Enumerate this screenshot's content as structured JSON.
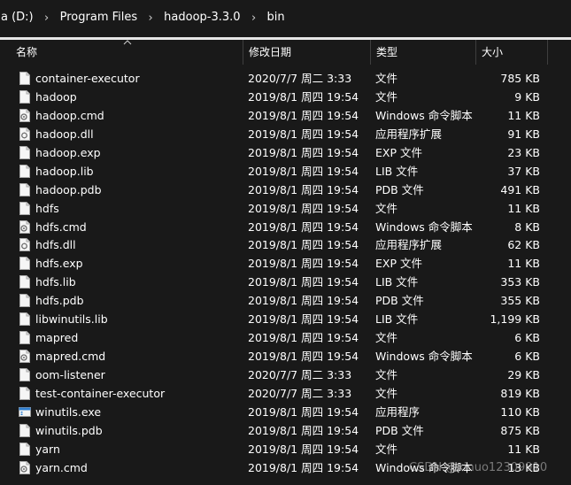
{
  "breadcrumb": [
    {
      "label": "a (D:)"
    },
    {
      "label": "Program Files"
    },
    {
      "label": "hadoop-3.3.0"
    },
    {
      "label": "bin"
    }
  ],
  "breadcrumb_separator": "›",
  "columns": {
    "name": "名称",
    "date": "修改日期",
    "type": "类型",
    "size": "大小"
  },
  "files": [
    {
      "name": "container-executor",
      "date": "2020/7/7 周二 3:33",
      "type": "文件",
      "size": "785 KB",
      "icon": "blank-file-icon"
    },
    {
      "name": "hadoop",
      "date": "2019/8/1 周四 19:54",
      "type": "文件",
      "size": "9 KB",
      "icon": "blank-file-icon"
    },
    {
      "name": "hadoop.cmd",
      "date": "2019/8/1 周四 19:54",
      "type": "Windows 命令脚本",
      "size": "11 KB",
      "icon": "gear-file-icon"
    },
    {
      "name": "hadoop.dll",
      "date": "2019/8/1 周四 19:54",
      "type": "应用程序扩展",
      "size": "91 KB",
      "icon": "dll-file-icon"
    },
    {
      "name": "hadoop.exp",
      "date": "2019/8/1 周四 19:54",
      "type": "EXP 文件",
      "size": "23 KB",
      "icon": "blank-file-icon"
    },
    {
      "name": "hadoop.lib",
      "date": "2019/8/1 周四 19:54",
      "type": "LIB 文件",
      "size": "37 KB",
      "icon": "blank-file-icon"
    },
    {
      "name": "hadoop.pdb",
      "date": "2019/8/1 周四 19:54",
      "type": "PDB 文件",
      "size": "491 KB",
      "icon": "blank-file-icon"
    },
    {
      "name": "hdfs",
      "date": "2019/8/1 周四 19:54",
      "type": "文件",
      "size": "11 KB",
      "icon": "blank-file-icon"
    },
    {
      "name": "hdfs.cmd",
      "date": "2019/8/1 周四 19:54",
      "type": "Windows 命令脚本",
      "size": "8 KB",
      "icon": "gear-file-icon"
    },
    {
      "name": "hdfs.dll",
      "date": "2019/8/1 周四 19:54",
      "type": "应用程序扩展",
      "size": "62 KB",
      "icon": "dll-file-icon"
    },
    {
      "name": "hdfs.exp",
      "date": "2019/8/1 周四 19:54",
      "type": "EXP 文件",
      "size": "11 KB",
      "icon": "blank-file-icon"
    },
    {
      "name": "hdfs.lib",
      "date": "2019/8/1 周四 19:54",
      "type": "LIB 文件",
      "size": "353 KB",
      "icon": "blank-file-icon"
    },
    {
      "name": "hdfs.pdb",
      "date": "2019/8/1 周四 19:54",
      "type": "PDB 文件",
      "size": "355 KB",
      "icon": "blank-file-icon"
    },
    {
      "name": "libwinutils.lib",
      "date": "2019/8/1 周四 19:54",
      "type": "LIB 文件",
      "size": "1,199 KB",
      "icon": "blank-file-icon"
    },
    {
      "name": "mapred",
      "date": "2019/8/1 周四 19:54",
      "type": "文件",
      "size": "6 KB",
      "icon": "blank-file-icon"
    },
    {
      "name": "mapred.cmd",
      "date": "2019/8/1 周四 19:54",
      "type": "Windows 命令脚本",
      "size": "6 KB",
      "icon": "gear-file-icon"
    },
    {
      "name": "oom-listener",
      "date": "2020/7/7 周二 3:33",
      "type": "文件",
      "size": "29 KB",
      "icon": "blank-file-icon"
    },
    {
      "name": "test-container-executor",
      "date": "2020/7/7 周二 3:33",
      "type": "文件",
      "size": "819 KB",
      "icon": "blank-file-icon"
    },
    {
      "name": "winutils.exe",
      "date": "2019/8/1 周四 19:54",
      "type": "应用程序",
      "size": "110 KB",
      "icon": "exe-file-icon"
    },
    {
      "name": "winutils.pdb",
      "date": "2019/8/1 周四 19:54",
      "type": "PDB 文件",
      "size": "875 KB",
      "icon": "blank-file-icon"
    },
    {
      "name": "yarn",
      "date": "2019/8/1 周四 19:54",
      "type": "文件",
      "size": "11 KB",
      "icon": "blank-file-icon"
    },
    {
      "name": "yarn.cmd",
      "date": "2019/8/1 周四 19:54",
      "type": "Windows 命令脚本",
      "size": "13 KB",
      "icon": "gear-file-icon"
    }
  ],
  "watermark": "CSDN @xinuo12309910",
  "colors": {
    "background": "#191919",
    "text": "#ffffff",
    "divider": "#e6e6e6",
    "header_separator": "#3e3e3e",
    "exe_icon_blue": "#2f7fd1"
  }
}
